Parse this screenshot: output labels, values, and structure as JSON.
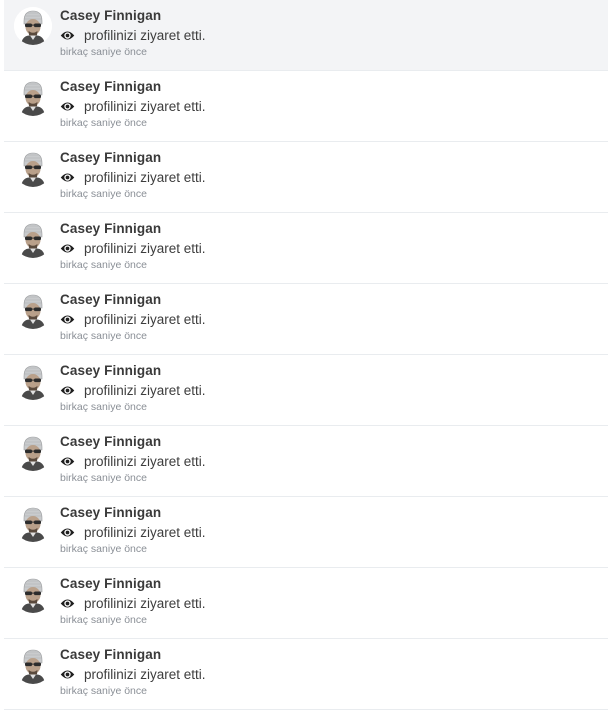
{
  "notifications": [
    {
      "name": "Casey Finnigan",
      "icon": "eye-icon",
      "action": "profilinizi ziyaret etti.",
      "time": "birkaç saniye önce",
      "highlighted": true
    },
    {
      "name": "Casey Finnigan",
      "icon": "eye-icon",
      "action": "profilinizi ziyaret etti.",
      "time": "birkaç saniye önce",
      "highlighted": false
    },
    {
      "name": "Casey Finnigan",
      "icon": "eye-icon",
      "action": "profilinizi ziyaret etti.",
      "time": "birkaç saniye önce",
      "highlighted": false
    },
    {
      "name": "Casey Finnigan",
      "icon": "eye-icon",
      "action": "profilinizi ziyaret etti.",
      "time": "birkaç saniye önce",
      "highlighted": false
    },
    {
      "name": "Casey Finnigan",
      "icon": "eye-icon",
      "action": "profilinizi ziyaret etti.",
      "time": "birkaç saniye önce",
      "highlighted": false
    },
    {
      "name": "Casey Finnigan",
      "icon": "eye-icon",
      "action": "profilinizi ziyaret etti.",
      "time": "birkaç saniye önce",
      "highlighted": false
    },
    {
      "name": "Casey Finnigan",
      "icon": "eye-icon",
      "action": "profilinizi ziyaret etti.",
      "time": "birkaç saniye önce",
      "highlighted": false
    },
    {
      "name": "Casey Finnigan",
      "icon": "eye-icon",
      "action": "profilinizi ziyaret etti.",
      "time": "birkaç saniye önce",
      "highlighted": false
    },
    {
      "name": "Casey Finnigan",
      "icon": "eye-icon",
      "action": "profilinizi ziyaret etti.",
      "time": "birkaç saniye önce",
      "highlighted": false
    },
    {
      "name": "Casey Finnigan",
      "icon": "eye-icon",
      "action": "profilinizi ziyaret etti.",
      "time": "birkaç saniye önce",
      "highlighted": false
    }
  ],
  "colors": {
    "highlight_bg": "#f3f4f6",
    "divider": "#e9ecef",
    "name_text": "#3a3a3a",
    "time_text": "#8a8f96"
  }
}
